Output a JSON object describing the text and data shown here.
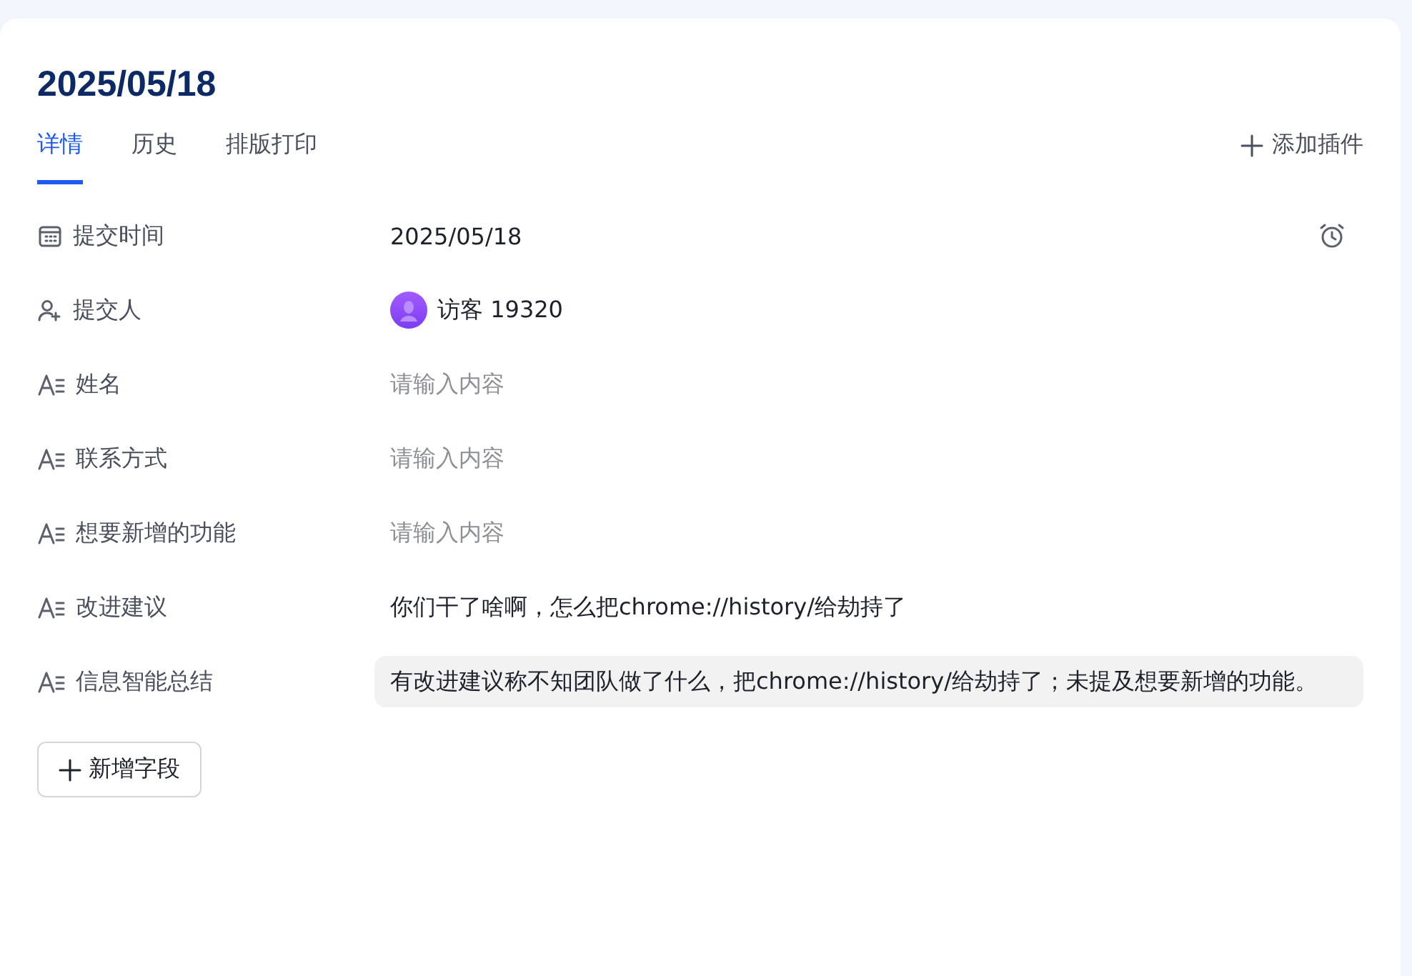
{
  "title": "2025/05/18",
  "tabs": [
    {
      "label": "详情",
      "selected": true
    },
    {
      "label": "历史",
      "selected": false
    },
    {
      "label": "排版打印",
      "selected": false
    }
  ],
  "add_plugin": {
    "label": "添加插件"
  },
  "fields": [
    {
      "kind": "date",
      "label": "提交时间",
      "value": "2025/05/18"
    },
    {
      "kind": "user",
      "label": "提交人",
      "value": "访客 19320"
    },
    {
      "kind": "text",
      "label": "姓名",
      "placeholder": "请输入内容"
    },
    {
      "kind": "text",
      "label": "联系方式",
      "placeholder": "请输入内容"
    },
    {
      "kind": "text",
      "label": "想要新增的功能",
      "placeholder": "请输入内容"
    },
    {
      "kind": "text",
      "label": "改进建议",
      "value": "你们干了啥啊，怎么把chrome://history/给劫持了"
    },
    {
      "kind": "summary",
      "label": "信息智能总结",
      "value": "有改进建议称不知团队做了什么，把chrome://history/给劫持了；未提及想要新增的功能。"
    }
  ],
  "add_field": {
    "label": "新增字段"
  }
}
